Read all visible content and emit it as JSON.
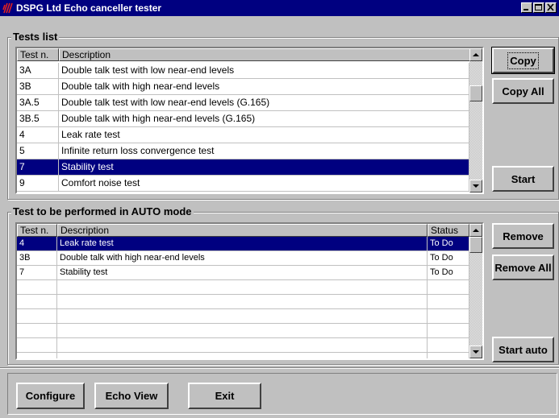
{
  "window": {
    "title": "DSPG Ltd  Echo canceller tester",
    "controls": [
      "minimize-icon",
      "maximize-icon",
      "close-icon"
    ]
  },
  "tests_list": {
    "group_title": "Tests list",
    "columns": [
      "Test n.",
      "Description"
    ],
    "rows": [
      {
        "id": "3A",
        "description": "Double talk test with low near-end levels",
        "selected": false
      },
      {
        "id": "3B",
        "description": "Double talk with high near-end levels",
        "selected": false
      },
      {
        "id": "3A.5",
        "description": "Double talk test with low near-end levels (G.165)",
        "selected": false
      },
      {
        "id": "3B.5",
        "description": "Double talk with high near-end levels (G.165)",
        "selected": false
      },
      {
        "id": "4",
        "description": "Leak rate test",
        "selected": false
      },
      {
        "id": "5",
        "description": "Infinite return loss convergence test",
        "selected": false
      },
      {
        "id": "7",
        "description": "Stability test",
        "selected": true
      },
      {
        "id": "9",
        "description": "Comfort noise test",
        "selected": false
      }
    ],
    "buttons": {
      "copy": "Copy",
      "copy_all": "Copy All",
      "start": "Start"
    }
  },
  "auto_list": {
    "group_title": "Test to be performed in AUTO mode",
    "columns": [
      "Test n.",
      "Description",
      "Status"
    ],
    "rows": [
      {
        "id": "4",
        "description": "Leak rate test",
        "status": "To Do",
        "selected": true
      },
      {
        "id": "3B",
        "description": "Double talk with high near-end levels",
        "status": "To Do",
        "selected": false
      },
      {
        "id": "7",
        "description": "Stability test",
        "status": "To Do",
        "selected": false
      }
    ],
    "empty_rows": 6,
    "buttons": {
      "remove": "Remove",
      "remove_all": "Remove All",
      "start_auto": "Start auto"
    }
  },
  "footer": {
    "configure": "Configure",
    "echo_view": "Echo View",
    "exit": "Exit"
  },
  "colors": {
    "titlebar": "#000080",
    "selection": "#000080",
    "face": "#c0c0c0"
  }
}
